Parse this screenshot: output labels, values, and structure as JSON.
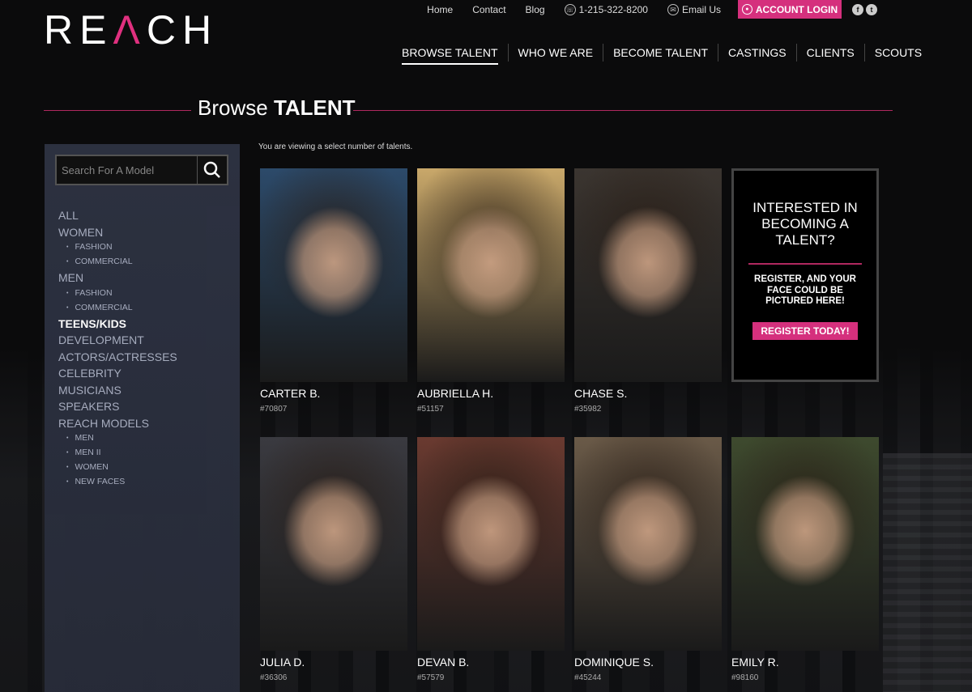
{
  "brand": {
    "logo_text_1": "RE",
    "logo_text_a": "Λ",
    "logo_text_2": "CH"
  },
  "top_nav": {
    "home": "Home",
    "contact": "Contact",
    "blog": "Blog",
    "phone": "1-215-322-8200",
    "email": "Email Us",
    "account_login": "ACCOUNT LOGIN",
    "facebook": "f",
    "twitter": "t"
  },
  "main_nav": [
    {
      "label": "BROWSE TALENT",
      "active": true
    },
    {
      "label": "WHO WE ARE"
    },
    {
      "label": "BECOME TALENT"
    },
    {
      "label": "CASTINGS"
    },
    {
      "label": "CLIENTS"
    },
    {
      "label": "SCOUTS"
    }
  ],
  "page_title": {
    "light": "Browse",
    "bold": "TALENT"
  },
  "sidebar": {
    "search_placeholder": "Search For A Model",
    "categories": {
      "all": "ALL",
      "women": "WOMEN",
      "women_fashion": "FASHION",
      "women_commercial": "COMMERCIAL",
      "men": "MEN",
      "men_fashion": "FASHION",
      "men_commercial": "COMMERCIAL",
      "teens_kids": "TEENS/KIDS",
      "development": "DEVELOPMENT",
      "actors": "ACTORS/ACTRESSES",
      "celebrity": "CELEBRITY",
      "musicians": "MUSICIANS",
      "speakers": "SPEAKERS",
      "reach_models": "REACH MODELS",
      "rm_men": "MEN",
      "rm_men_ii": "MEN II",
      "rm_women": "WOMEN",
      "rm_new_faces": "NEW FACES"
    }
  },
  "notice": "You are viewing a select number of talents.",
  "talents": [
    {
      "name": "CARTER B.",
      "id": "#70807",
      "bg": "#2c4a6a"
    },
    {
      "name": "AUBRIELLA H.",
      "id": "#51157",
      "bg": "#c9a86a"
    },
    {
      "name": "CHASE S.",
      "id": "#35982",
      "bg": "#3b3530"
    },
    {
      "name": "JULIA D.",
      "id": "#36306",
      "bg": "#3a3a40"
    },
    {
      "name": "DEVAN B.",
      "id": "#57579",
      "bg": "#6a3a30"
    },
    {
      "name": "DOMINIQUE S.",
      "id": "#45244",
      "bg": "#6a5a48"
    },
    {
      "name": "EMILY R.",
      "id": "#98160",
      "bg": "#3e4a2e"
    }
  ],
  "cta": {
    "heading": "INTERESTED IN BECOMING A TALENT?",
    "text": "REGISTER, AND YOUR FACE COULD BE PICTURED HERE!",
    "button": "REGISTER TODAY!"
  },
  "colors": {
    "accent": "#d5307d",
    "sidebar": "#2d3242",
    "background": "#0b0b0c"
  }
}
